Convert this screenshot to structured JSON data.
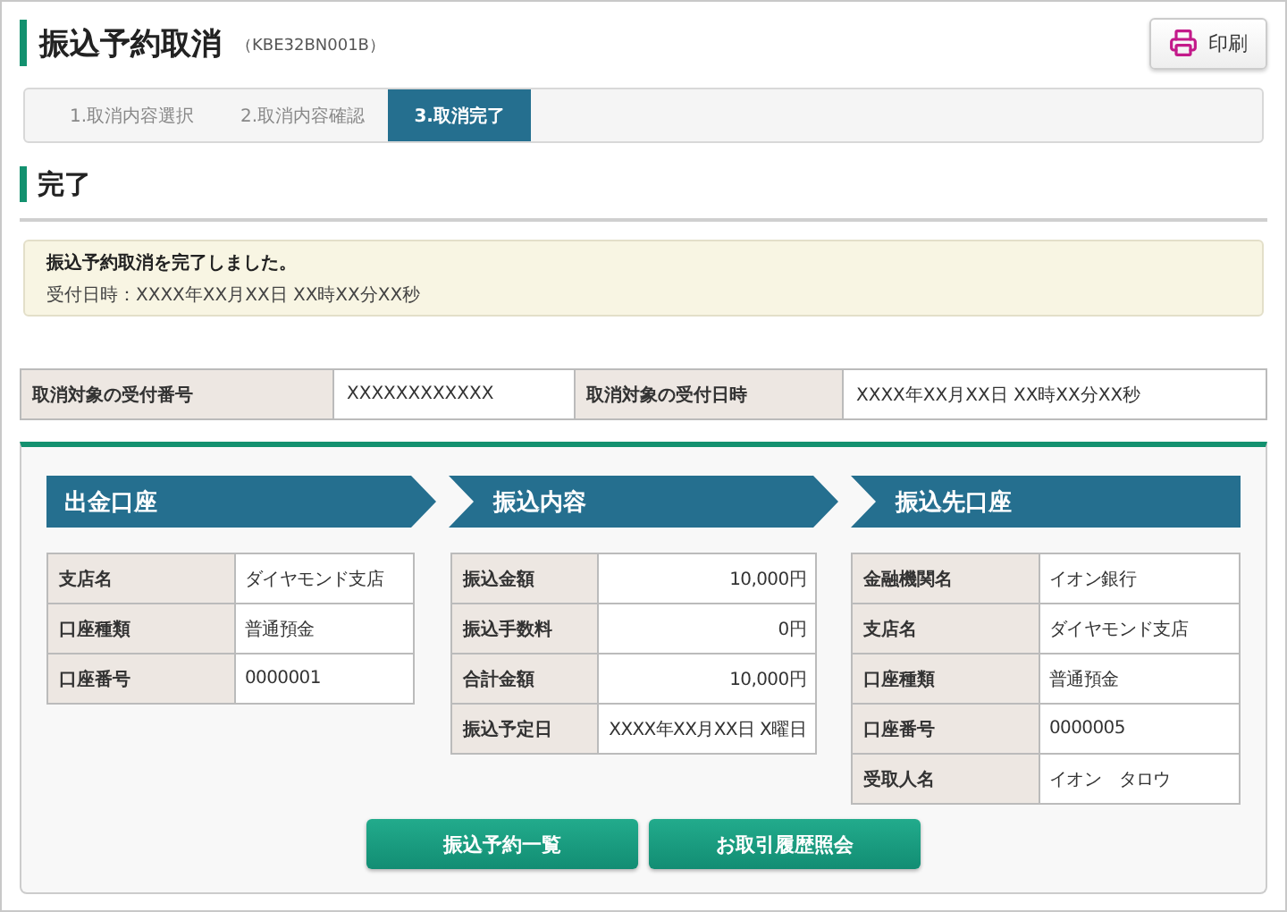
{
  "header": {
    "title": "振込予約取消",
    "screen_id": "（KBE32BN001B）",
    "print_button": "印刷"
  },
  "steps": [
    {
      "label": "1.取消内容選択",
      "selected": false
    },
    {
      "label": "2.取消内容確認",
      "selected": false
    },
    {
      "label": "3.取消完了",
      "selected": true
    }
  ],
  "section_title": "完了",
  "message": {
    "headline": "振込予約取消を完了しました。",
    "detail": "受付日時：XXXX年XX月XX日 XX時XX分XX秒"
  },
  "summary": [
    {
      "label": "取消対象の受付番号",
      "value": "XXXXXXXXXXXX"
    },
    {
      "label": "取消対象の受付日時",
      "value": "XXXX年XX月XX日 XX時XX分XX秒"
    }
  ],
  "panels": [
    {
      "title": "出金口座",
      "kind": "details",
      "rows": [
        {
          "label": "支店名",
          "value": "ダイヤモンド支店"
        },
        {
          "label": "口座種類",
          "value": "普通預金"
        },
        {
          "label": "口座番号",
          "value": "0000001"
        }
      ]
    },
    {
      "title": "振込内容",
      "kind": "amounts",
      "rows": [
        {
          "label": "振込金額",
          "value": "10,000円"
        },
        {
          "label": "振込手数料",
          "value": "0円"
        },
        {
          "label": "合計金額",
          "value": "10,000円"
        },
        {
          "label": "振込予定日",
          "value": "XXXX年XX月XX日 X曜日"
        }
      ]
    },
    {
      "title": "振込先口座",
      "kind": "details",
      "rows": [
        {
          "label": "金融機関名",
          "value": "イオン銀行"
        },
        {
          "label": "支店名",
          "value": "ダイヤモンド支店"
        },
        {
          "label": "口座種類",
          "value": "普通預金"
        },
        {
          "label": "口座番号",
          "value": "0000005"
        },
        {
          "label": "受取人名",
          "value": "イオン　タロウ"
        }
      ]
    }
  ],
  "buttons": [
    "振込予約一覧",
    "お取引履歴照会"
  ]
}
